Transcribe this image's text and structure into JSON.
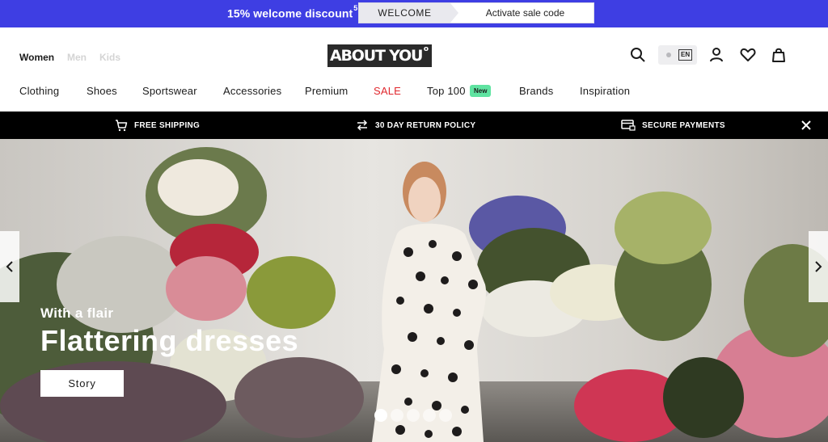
{
  "promo": {
    "text": "15% welcome discount",
    "footnote": "5",
    "code": "WELCOME",
    "action": "Activate sale code",
    "background": "#3e3ee3"
  },
  "header": {
    "genders": [
      "Women",
      "Men",
      "Kids"
    ],
    "logo": "ABOUT YOU",
    "logo_mark": "o",
    "icons": [
      "search-icon",
      "language-switch",
      "account-icon",
      "wishlist-heart-icon",
      "shopping-bag-icon"
    ],
    "language": "EN"
  },
  "nav": {
    "items": [
      "Clothing",
      "Shoes",
      "Sportswear",
      "Accessories",
      "Premium",
      "SALE",
      "Top 100",
      "Brands",
      "Inspiration"
    ],
    "new_badge": "New",
    "sale_color": "#e0282e",
    "badge_color": "#5fe3a1"
  },
  "usp": {
    "items": [
      "FREE SHIPPING",
      "30 DAY RETURN POLICY",
      "SECURE PAYMENTS"
    ],
    "icons": [
      "cart-icon",
      "return-arrows-icon",
      "card-lock-icon"
    ]
  },
  "hero": {
    "subtitle": "With a flair",
    "title": "Flattering dresses",
    "button": "Story",
    "slide_count": 5,
    "active_slide": 1
  }
}
